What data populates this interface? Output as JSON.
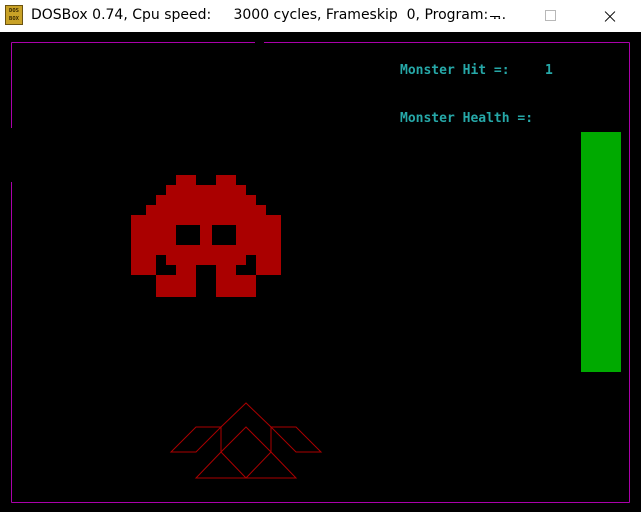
{
  "window": {
    "icon_text_line1": "DOS",
    "icon_text_line2": "BOX",
    "title": "DOSBox 0.74, Cpu speed:     3000 cycles, Frameskip  0, Program: ..."
  },
  "hud": {
    "monster_hit_label": "Monster Hit =:",
    "monster_hit_value": "1",
    "monster_health_label": "Monster Health =:",
    "monster_health_fraction": 1.0
  },
  "colors": {
    "background": "#000000",
    "border": "#aa00aa",
    "hud_text": "#26a8a8",
    "health_bar": "#00aa00",
    "monster": "#aa0000",
    "ship": "#aa0000"
  }
}
